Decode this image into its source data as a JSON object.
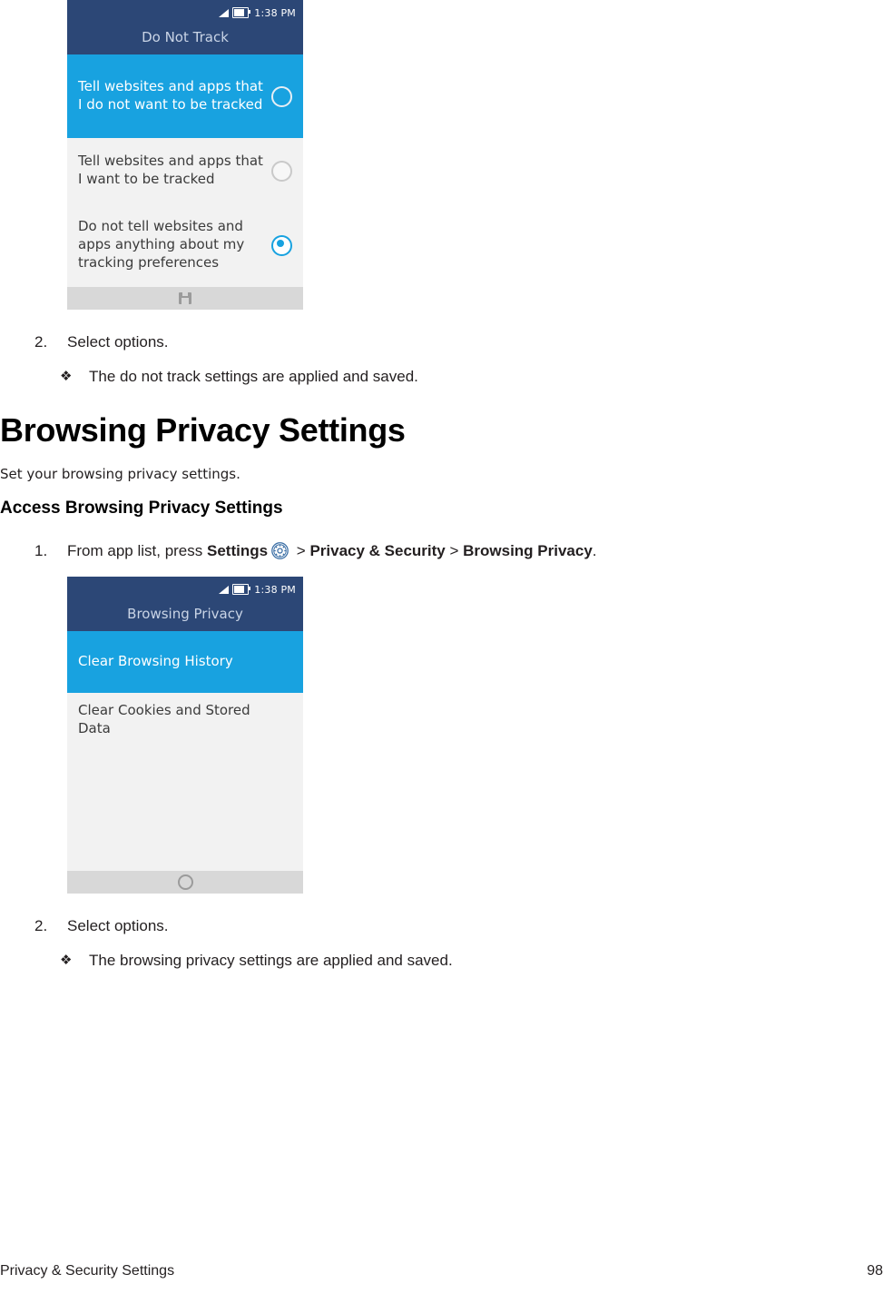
{
  "phone1": {
    "status": {
      "time": "1:38 PM",
      "signal_icon": "signal-triangle-icon",
      "battery_icon": "battery-icon"
    },
    "title": "Do Not Track",
    "rows": [
      {
        "label": "Tell websites and apps that I do not want to be tracked",
        "selected": false,
        "highlighted": true
      },
      {
        "label": "Tell websites and apps that I want to be tracked",
        "selected": false,
        "highlighted": false
      },
      {
        "label": "Do not tell websites and apps anything about my tracking preferences",
        "selected": true,
        "highlighted": false
      }
    ],
    "nav_icon": "save-icon"
  },
  "body": {
    "step1_do_not_track": {
      "number": "2.",
      "text": "Select options."
    },
    "bullet1": {
      "marker": "❖",
      "text": "The do not track settings are applied and saved."
    },
    "heading1": "Browsing Privacy Settings",
    "intro": "Set your browsing privacy settings.",
    "heading2": "Access Browsing Privacy Settings",
    "step1_browsing": {
      "number": "1.",
      "prefix": "From app list, press ",
      "settings_label": "Settings",
      "gear_icon": "gear-icon",
      "sep1": " > ",
      "privacy_label": "Privacy & Security",
      "sep2": " > ",
      "browsing_label": "Browsing Privacy",
      "period": "."
    },
    "step2_browsing": {
      "number": "2.",
      "text": "Select options."
    },
    "bullet2": {
      "marker": "❖",
      "text": "The browsing privacy settings are applied and saved."
    }
  },
  "phone2": {
    "status": {
      "time": "1:38 PM",
      "signal_icon": "signal-triangle-icon",
      "battery_icon": "battery-icon"
    },
    "title": "Browsing Privacy",
    "rows": [
      {
        "label": "Clear Browsing History",
        "highlighted": true
      },
      {
        "label": "Clear Cookies and Stored Data",
        "highlighted": false
      }
    ],
    "nav_icon": "home-circle-icon"
  },
  "footer": {
    "left": "Privacy & Security Settings",
    "right": "98"
  },
  "colors": {
    "status_bar": "#2c4776",
    "highlight": "#18a2e0",
    "row_bg": "#f2f2f2",
    "nav_bg": "#d8d8d8"
  }
}
